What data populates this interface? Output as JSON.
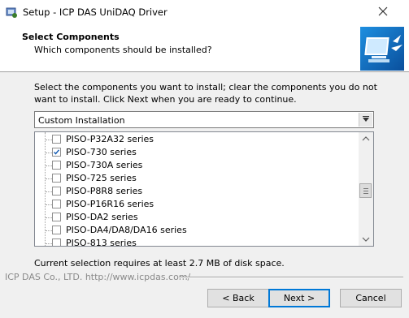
{
  "window": {
    "title": "Setup - ICP DAS UniDAQ Driver"
  },
  "header": {
    "title": "Select Components",
    "subtitle": "Which components should be installed?"
  },
  "description": "Select the components you want to install; clear the components you do not want to install. Click Next when you are ready to continue.",
  "install_type": {
    "selected": "Custom Installation"
  },
  "components": [
    {
      "label": "PISO-P32A32 series",
      "checked": false
    },
    {
      "label": "PISO-730 series",
      "checked": true
    },
    {
      "label": "PISO-730A series",
      "checked": false
    },
    {
      "label": "PISO-725 series",
      "checked": false
    },
    {
      "label": "PISO-P8R8 series",
      "checked": false
    },
    {
      "label": "PISO-P16R16 series",
      "checked": false
    },
    {
      "label": "PISO-DA2 series",
      "checked": false
    },
    {
      "label": "PISO-DA4/DA8/DA16 series",
      "checked": false
    },
    {
      "label": "PISO-813 series",
      "checked": false
    }
  ],
  "disk_space_text": "Current selection requires at least 2.7 MB of disk space.",
  "branding": "ICP DAS Co., LTD. http://www.icpdas.com/",
  "buttons": {
    "back_label": "< Back",
    "next_label": "Next >",
    "cancel_label": "Cancel"
  },
  "colors": {
    "check_blue": "#1a5fb4",
    "accent": "#0078d7"
  }
}
